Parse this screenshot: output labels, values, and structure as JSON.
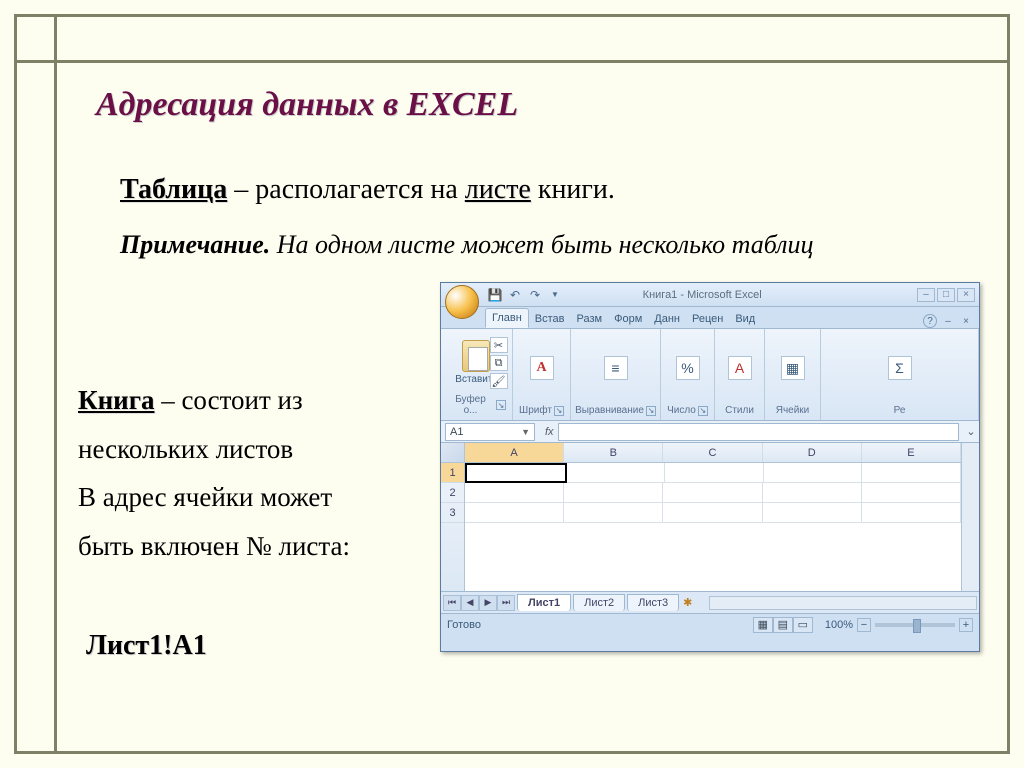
{
  "slide": {
    "title": "Адресация данных в EXCEL",
    "line1_bold": "Таблица",
    "line1_mid": " – располагается на ",
    "line1_under": "листе",
    "line1_end": " книги.",
    "note_bold": "Примечание.",
    "note_rest": " На одном листе может быть несколько таблиц",
    "book_bold": "Книга",
    "book_l1": " – состоит из",
    "book_l2": "нескольких листов",
    "book_l3": "В адрес ячейки может",
    "book_l4": "быть включен № листа:",
    "sheet_ref": "Лист1!A1"
  },
  "excel": {
    "window_title": "Книга1 - Microsoft Excel",
    "tabs": [
      "Главн",
      "Встав",
      "Разм",
      "Форм",
      "Данн",
      "Рецен",
      "Вид"
    ],
    "groups": {
      "paste": "Вставить",
      "clipboard": "Буфер о...",
      "font": "Шрифт",
      "align": "Выравнивание",
      "number": "Число",
      "styles": "Стили",
      "cells": "Ячейки",
      "edit": "Ре"
    },
    "namebox": "A1",
    "fx": "fx",
    "columns": [
      "A",
      "B",
      "C",
      "D",
      "E"
    ],
    "rows": [
      "1",
      "2",
      "3"
    ],
    "sheets": [
      "Лист1",
      "Лист2",
      "Лист3"
    ],
    "status": "Готово",
    "zoom": "100%"
  }
}
